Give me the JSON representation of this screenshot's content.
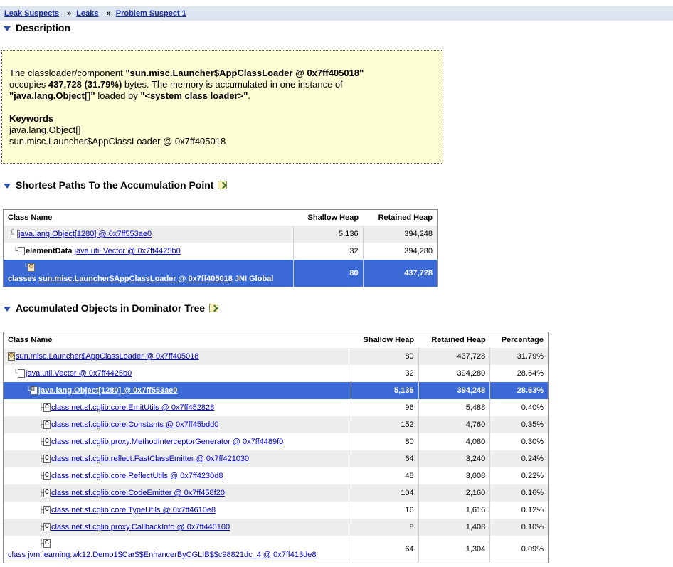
{
  "breadcrumb": {
    "items": [
      "Leak Suspects",
      "Leaks",
      "Problem Suspect 1"
    ],
    "separator": "»"
  },
  "description": {
    "heading": "Description",
    "text_1": "The classloader/component ",
    "loader": "\"sun.misc.Launcher$AppClassLoader @ 0x7ff405018\"",
    "text_2": "occupies ",
    "bytes": "437,728 (31.79%)",
    "text_3": " bytes. The memory is accumulated in one instance of",
    "instance_type": "\"java.lang.Object[]\"",
    "text_4": " loaded by ",
    "instance_loader": "\"<system class loader>\"",
    "text_5": ".",
    "keywords_title": "Keywords",
    "keywords": [
      "java.lang.Object[]",
      "sun.misc.Launcher$AppClassLoader @ 0x7ff405018"
    ]
  },
  "paths": {
    "heading": "Shortest Paths To the Accumulation Point",
    "columns": [
      "Class Name",
      "Shallow Heap",
      "Retained Heap"
    ],
    "rows": [
      {
        "prefix": "",
        "link": "java.lang.Object[1280] @ 0x7ff553ae0",
        "suffix": "",
        "shallow": "5,136",
        "retained": "394,248"
      },
      {
        "prefix": "elementData",
        "link": "java.util.Vector @ 0x7ff4425b0",
        "suffix": "",
        "shallow": "32",
        "retained": "394,280"
      },
      {
        "prefix": "classes",
        "link": "sun.misc.Launcher$AppClassLoader @ 0x7ff405018",
        "suffix": "JNI Global",
        "shallow": "80",
        "retained": "437,728"
      }
    ]
  },
  "dominator": {
    "heading": "Accumulated Objects in Dominator Tree",
    "columns": [
      "Class Name",
      "Shallow Heap",
      "Retained Heap",
      "Percentage"
    ],
    "rows": [
      {
        "link": "sun.misc.Launcher$AppClassLoader @ 0x7ff405018",
        "shallow": "80",
        "retained": "437,728",
        "pct": "31.79%"
      },
      {
        "link": "java.util.Vector @ 0x7ff4425b0",
        "shallow": "32",
        "retained": "394,280",
        "pct": "28.64%"
      },
      {
        "link": "java.lang.Object[1280] @ 0x7ff553ae0",
        "shallow": "5,136",
        "retained": "394,248",
        "pct": "28.63%"
      },
      {
        "link": "class net.sf.cglib.core.EmitUtils @ 0x7ff452828",
        "shallow": "96",
        "retained": "5,488",
        "pct": "0.40%"
      },
      {
        "link": "class net.sf.cglib.core.Constants @ 0x7ff45bdd0",
        "shallow": "152",
        "retained": "4,760",
        "pct": "0.35%"
      },
      {
        "link": "class net.sf.cglib.proxy.MethodInterceptorGenerator @ 0x7ff4489f0",
        "shallow": "80",
        "retained": "4,080",
        "pct": "0.30%"
      },
      {
        "link": "class net.sf.cglib.reflect.FastClassEmitter @ 0x7ff421030",
        "shallow": "64",
        "retained": "3,240",
        "pct": "0.24%"
      },
      {
        "link": "class net.sf.cglib.core.ReflectUtils @ 0x7ff4230d8",
        "shallow": "48",
        "retained": "3,008",
        "pct": "0.22%"
      },
      {
        "link": "class net.sf.cglib.core.CodeEmitter @ 0x7ff458f20",
        "shallow": "104",
        "retained": "2,160",
        "pct": "0.16%"
      },
      {
        "link": "class net.sf.cglib.core.TypeUtils @ 0x7ff4610e8",
        "shallow": "16",
        "retained": "1,616",
        "pct": "0.12%"
      },
      {
        "link": "class net.sf.cglib.proxy.CallbackInfo @ 0x7ff445100",
        "shallow": "8",
        "retained": "1,408",
        "pct": "0.10%"
      },
      {
        "link": "class jvm.learning.wk12.Demo1$Car$$EnhancerByCGLIB$$c98821dc_4 @ 0x7ff413de8",
        "shallow": "64",
        "retained": "1,304",
        "pct": "0.09%"
      }
    ]
  }
}
